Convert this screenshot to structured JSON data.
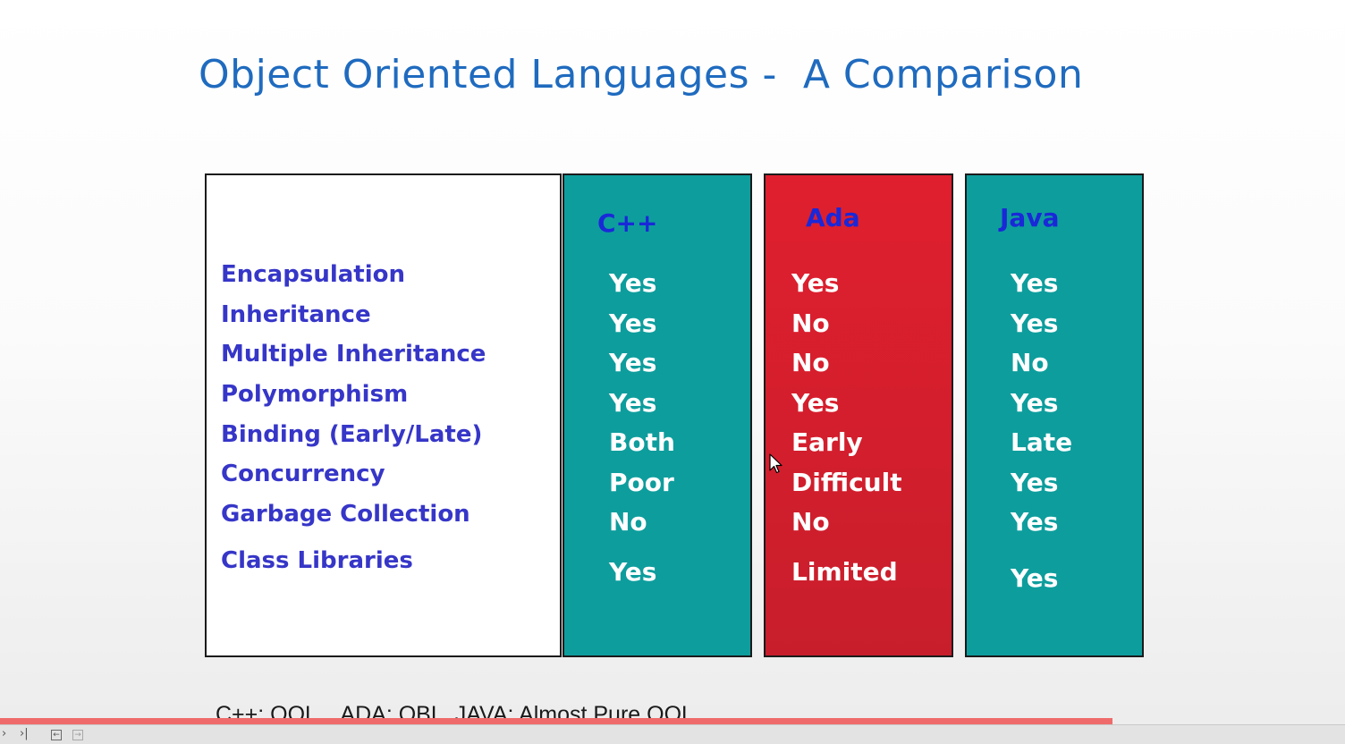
{
  "slide": {
    "title": "Object Oriented Languages -  A Comparison",
    "footnote": "C++: OOL    ADA: OBL  JAVA: Almost Pure OOL"
  },
  "table": {
    "features": [
      "Encapsulation",
      "Inheritance",
      "Multiple Inheritance",
      "Polymorphism",
      "Binding (Early/Late)",
      "Concurrency",
      "Garbage Collection",
      "Class Libraries"
    ],
    "columns": [
      {
        "header": "C++",
        "color": "#0e9d9d",
        "values": [
          "Yes",
          "Yes",
          "Yes",
          "Yes",
          "Both",
          "Poor",
          "No",
          "Yes"
        ]
      },
      {
        "header": "Ada",
        "color": "#d81f2d",
        "values": [
          "Yes",
          "No",
          "No",
          "Yes",
          "Early",
          "Difficult",
          "No",
          "Limited"
        ]
      },
      {
        "header": "Java",
        "color": "#0e9d9d",
        "values": [
          "Yes",
          "Yes",
          "No",
          "Yes",
          "Late",
          "Yes",
          "Yes",
          "Yes"
        ]
      }
    ]
  },
  "player": {
    "progress": 0.827,
    "controls": [
      "next-icon",
      "last-icon",
      "back-icon",
      "forward-icon"
    ]
  }
}
